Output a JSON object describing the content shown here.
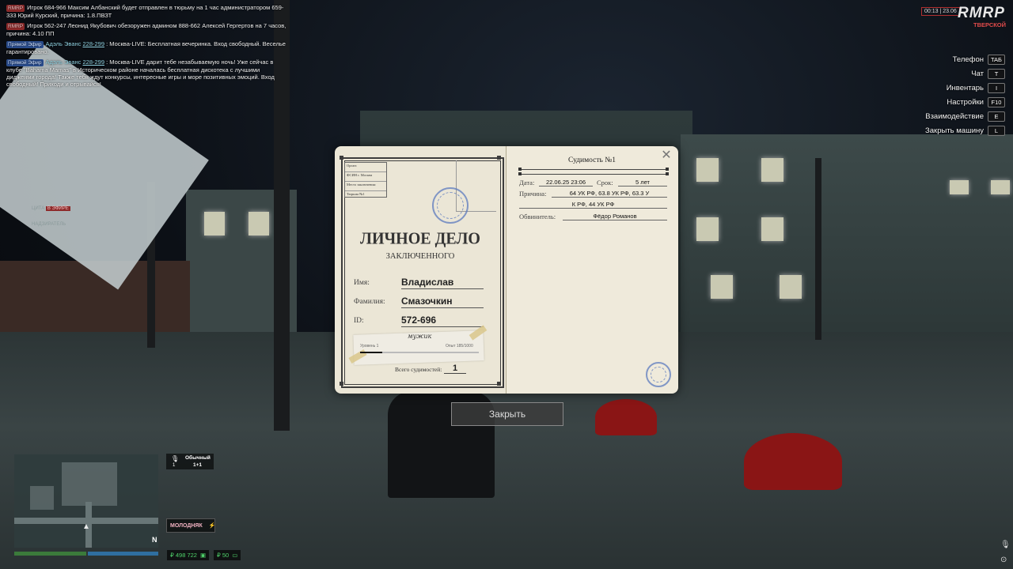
{
  "chat": [
    {
      "tag": "RMRP",
      "kind": "rmrp",
      "name": "",
      "phone": "",
      "text": "Игрок 684-966 Максим Албанский будет отправлен в тюрьму на 1 час администратором 659-333 Юрий Курский, причина: 1.8.ПВЗТ"
    },
    {
      "tag": "RMRP",
      "kind": "rmrp",
      "name": "",
      "phone": "",
      "text": "Игрок 562-247 Леонид Якубович обезоружен админом 888-662 Алексей Гергертов на 7 часов, причина: 4.10 ПП"
    },
    {
      "tag": "Прямой Эфир",
      "kind": "live",
      "name": "Адэль Эванс",
      "phone": "228-299",
      "text": ": Москва-LIVE: Бесплатная вечеринка. Вход свободный. Веселье гарантировано."
    },
    {
      "tag": "Прямой Эфир",
      "kind": "live",
      "name": "Адэль Эванс",
      "phone": "228-299",
      "text": ": Москва-LIVE дарит тебе незабываемую ночь! Уже сейчас в клубе \"Bahama Mamas\" в Историческом районе началась бесплатная дискотека с лучшими диджеями города! Также тебя ждут конкурсы, интересные игры и море позитивных эмоций. Вход свободный! Приходи и отрывайся!"
    }
  ],
  "top_right": {
    "time": "00:13 | 23.06",
    "logo": "RMRP",
    "server": "ТВЕРСКОЙ"
  },
  "hotkeys": [
    {
      "label": "Телефон",
      "key": "TAБ"
    },
    {
      "label": "Чат",
      "key": "T"
    },
    {
      "label": "Инвентарь",
      "key": "I"
    },
    {
      "label": "Настройки",
      "key": "F10"
    },
    {
      "label": "Взаимодействие",
      "key": "E"
    },
    {
      "label": "Закрыть машину",
      "key": "L"
    }
  ],
  "dossier": {
    "info_box": [
      "Орган:",
      "ФСИН г. Москва",
      "Место заключения:",
      "Тюрьма №1"
    ],
    "title": "ЛИЧНОЕ ДЕЛО",
    "subtitle": "ЗАКЛЮЧЕННОГО",
    "fields": {
      "name_label": "Имя:",
      "name_value": "Владислав",
      "surname_label": "Фамилия:",
      "surname_value": "Смазочкин",
      "id_label": "ID:",
      "id_value": "572-696"
    },
    "rank": "мужик",
    "level": "Уровень 1",
    "exp": "Опыт 185/1000",
    "exp_fraction": 0.185,
    "total_label": "Всего судимостей:",
    "total_value": "1",
    "conviction": {
      "title": "Судимость №1",
      "date_label": "Дата:",
      "date_value": "22.06.25 23:06",
      "term_label": "Срок:",
      "term_value": "5 лет",
      "reason_label": "Причина:",
      "reason_line1": "64 УК РФ, 63.8 УК РФ, 63.3 У",
      "reason_line2": "К РФ, 44 УК РФ",
      "accuser_label": "Обвинитель:",
      "accuser_value": "Фёдор Романов"
    },
    "close_symbol": "✕"
  },
  "close_button": "Закрыть",
  "hud": {
    "voice_mode": "Обычный",
    "voice_channel": "1+1",
    "voice_num": "1",
    "gang": "МОЛОДНЯК",
    "money_cash": "₽ 498 722",
    "money_bank": "₽ 50",
    "compass": "N",
    "faded_1": "ЦИТА",
    "faded_badge": "В ЭФИРЕ",
    "faded_2": "НАДЗИРАТЕЛЬ"
  },
  "colors": {
    "health": "#3b7b3b",
    "armor": "#2f6fa0",
    "money": "#4fd16a",
    "brand_red": "#e24b4b"
  }
}
